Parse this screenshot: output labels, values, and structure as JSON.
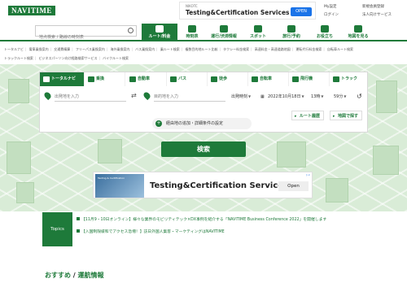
{
  "header": {
    "logo": "NAVITIME",
    "ad": {
      "small": "NIKOTC",
      "title": "Testing&Certification Services",
      "button": "OPEN"
    },
    "links": [
      "My設定",
      "新規会員登録",
      "ログイン",
      "法人向けサービス"
    ]
  },
  "nav": {
    "search_placeholder": "地点検索 / 路線の時刻表",
    "tabs": [
      {
        "label": "ルート/料金",
        "icon": "route-icon",
        "active": true
      },
      {
        "label": "時刻表",
        "icon": "timetable-icon"
      },
      {
        "label": "運行/渋滞情報",
        "icon": "traffic-info-icon"
      },
      {
        "label": "スポット",
        "icon": "spot-icon"
      },
      {
        "label": "旅行/予約",
        "icon": "travel-icon"
      },
      {
        "label": "お役立ち",
        "icon": "useful-icon"
      },
      {
        "label": "地図を見る",
        "icon": "map-icon"
      }
    ]
  },
  "links": [
    "トータルナビ",
    "電車乗換案内",
    "交通費精算",
    "フリーパス乗換案内",
    "海外乗換案内",
    "バス乗換案内",
    "乗ルート検索",
    "複数目的地ルート比較",
    "タクシー料金検索",
    "高速料金・高速道路地図",
    "運転代行料金検索",
    "自転車ルート検索",
    "トラックルート検索",
    "ビジネスパーソン向け経路検索サービス",
    "バイクルート検索"
  ],
  "mode_tabs": [
    {
      "label": "トータルナビ",
      "icon": "total-navi-icon",
      "active": true
    },
    {
      "label": "乗換",
      "icon": "train-icon"
    },
    {
      "label": "自動車",
      "icon": "car-icon"
    },
    {
      "label": "バス",
      "icon": "bus-icon"
    },
    {
      "label": "徒歩",
      "icon": "walk-icon"
    },
    {
      "label": "自転車",
      "icon": "bicycle-icon"
    },
    {
      "label": "飛行機",
      "icon": "airplane-icon"
    },
    {
      "label": "トラック",
      "icon": "truck-icon"
    }
  ],
  "route_form": {
    "from_placeholder": "出発地を入力",
    "to_placeholder": "目的地を入力",
    "time_mode": "出発時刻",
    "date": "2022年10月18日",
    "hour": "13時",
    "minute": "59分",
    "history_button": "ルート履歴",
    "map_button": "地図で探す",
    "via_option": "経由地の追加・詳細条件の設定",
    "search_button": "検索"
  },
  "ad_banner": {
    "thumb_text": "Testing & Certification",
    "title": "Testing&Certification Services",
    "button": "Open",
    "ad_choice": "▷×"
  },
  "topics": {
    "label": "Topics",
    "items": [
      "【11月9・10日オンライン】様々な業界のモビリティテック×DX事例を紹介する「NAVITIME Business Conference 2022」を開催します",
      "【入国制限緩和でアクセス急増！】訪日外国人集客・マーケティングはNAVITIME"
    ]
  },
  "section": {
    "left": "おすすめ",
    "sep": " / ",
    "right": "運航情報"
  }
}
